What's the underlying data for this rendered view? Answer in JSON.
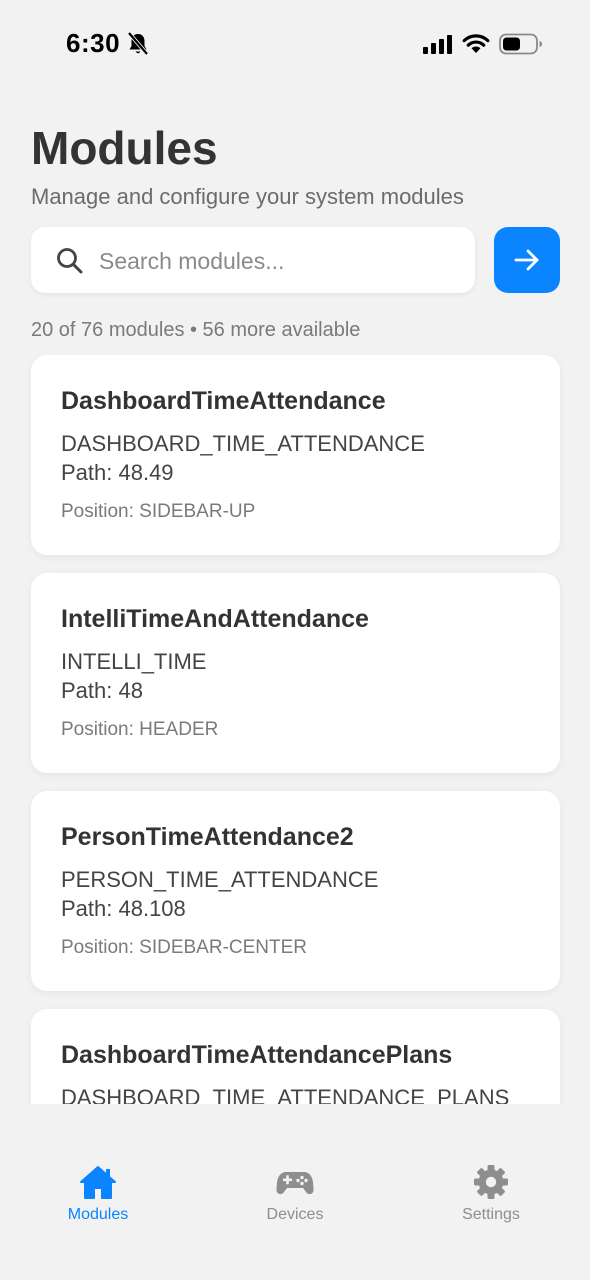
{
  "status_bar": {
    "time": "6:30"
  },
  "header": {
    "title": "Modules",
    "subtitle": "Manage and configure your system modules"
  },
  "search": {
    "placeholder": "Search modules...",
    "value": ""
  },
  "summary": {
    "count_text": "20 of 76 modules • 56 more available"
  },
  "modules": [
    {
      "name": "DashboardTimeAttendance",
      "code": "DASHBOARD_TIME_ATTENDANCE",
      "path": "Path: 48.49",
      "position": "Position: SIDEBAR-UP"
    },
    {
      "name": "IntelliTimeAndAttendance",
      "code": "INTELLI_TIME",
      "path": "Path: 48",
      "position": "Position: HEADER"
    },
    {
      "name": "PersonTimeAttendance2",
      "code": "PERSON_TIME_ATTENDANCE",
      "path": "Path: 48.108",
      "position": "Position: SIDEBAR-CENTER"
    },
    {
      "name": "DashboardTimeAttendancePlans",
      "code": "DASHBOARD_TIME_ATTENDANCE_PLANS",
      "path": "",
      "position": ""
    }
  ],
  "tabs": [
    {
      "label": "Modules",
      "icon": "home-icon",
      "active": true
    },
    {
      "label": "Devices",
      "icon": "gamepad-icon",
      "active": false
    },
    {
      "label": "Settings",
      "icon": "gear-icon",
      "active": false
    }
  ],
  "colors": {
    "accent": "#0a84ff",
    "background": "#f2f2f2",
    "card": "#ffffff",
    "inactive_tab": "#8e8e8e"
  }
}
